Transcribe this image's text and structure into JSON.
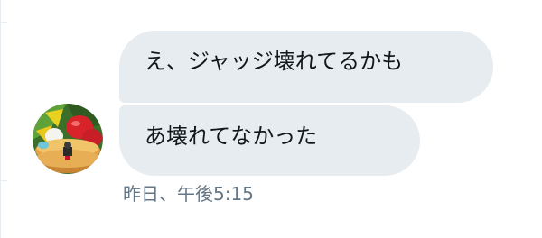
{
  "conversation": {
    "messages": [
      {
        "text": "え、ジャッジ壊れてるかも"
      },
      {
        "text": "あ壊れてなかった"
      }
    ],
    "timestamp": "昨日、午後5:15"
  },
  "theme": {
    "bubble_color": "#e6ecf0",
    "text_color": "#14171a",
    "timestamp_color": "#657786"
  },
  "icons": {
    "avatar": "user-avatar-pancake-strawberry"
  }
}
